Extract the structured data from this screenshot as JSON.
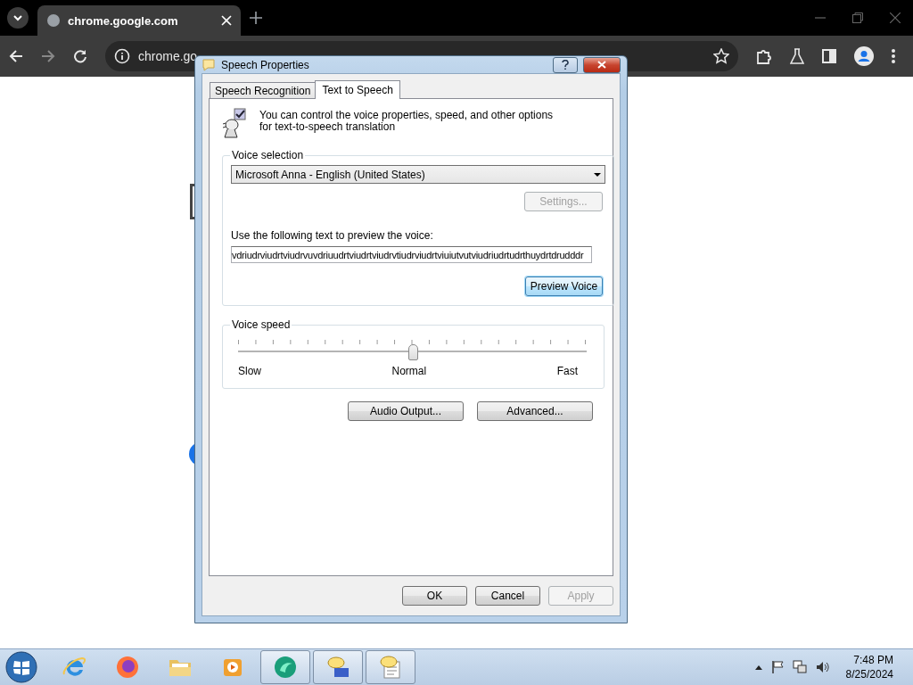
{
  "browser": {
    "tab_title": "chrome.google.com",
    "address": "chrome.go"
  },
  "dialog": {
    "title": "Speech Properties",
    "tabs": [
      {
        "label": "Speech Recognition",
        "selected": false
      },
      {
        "label": "Text to Speech",
        "selected": true
      }
    ],
    "intro": "You can control the voice properties, speed, and other options for text-to-speech translation",
    "voice_selection": {
      "legend": "Voice selection",
      "voice": "Microsoft Anna - English (United States)",
      "settings_button": {
        "label": "Settings...",
        "disabled": true
      },
      "preview_label": "Use the following text to preview the voice:",
      "preview_text": "vdriudrviudrtviudrvuvdriuudrtviudrtviudrvtiudrviudrtviuiutvutviudriudrtudrthuydrtdrudddr",
      "preview_button": "Preview Voice"
    },
    "voice_speed": {
      "legend": "Voice speed",
      "level": 0.5,
      "labels": [
        "Slow",
        "Normal",
        "Fast"
      ]
    },
    "buttons": [
      "Audio Output...",
      "Advanced..."
    ],
    "footer_buttons": [
      {
        "label": "OK",
        "disabled": false
      },
      {
        "label": "Cancel",
        "disabled": false
      },
      {
        "label": "Apply",
        "disabled": true
      }
    ]
  },
  "taskbar": {
    "apps": [
      {
        "kind": "ie",
        "active": false
      },
      {
        "kind": "firefox",
        "active": false
      },
      {
        "kind": "folder",
        "active": false
      },
      {
        "kind": "media",
        "active": false
      },
      {
        "kind": "globe",
        "active": true
      },
      {
        "kind": "chat",
        "active": true
      },
      {
        "kind": "note",
        "active": true
      }
    ],
    "time": "7:48 PM",
    "date": "8/25/2024"
  }
}
